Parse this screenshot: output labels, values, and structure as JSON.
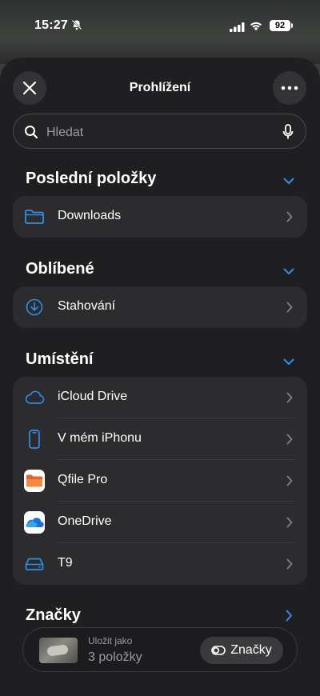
{
  "status_bar": {
    "time": "15:27",
    "battery": "92"
  },
  "sheet": {
    "title": "Prohlížení",
    "close_icon": "close-icon",
    "more_icon": "ellipsis-icon"
  },
  "search": {
    "placeholder": "Hledat",
    "icon": "search-icon",
    "mic_icon": "microphone-icon"
  },
  "sections": {
    "recent": {
      "title": "Poslední položky",
      "items": [
        {
          "label": "Downloads",
          "icon": "folder-icon"
        }
      ]
    },
    "favorites": {
      "title": "Oblíbené",
      "items": [
        {
          "label": "Stahování",
          "icon": "download-circle-icon"
        }
      ]
    },
    "locations": {
      "title": "Umístění",
      "items": [
        {
          "label": "iCloud Drive",
          "icon": "icloud-icon"
        },
        {
          "label": "V mém iPhonu",
          "icon": "iphone-icon"
        },
        {
          "label": "Qfile Pro",
          "icon": "qfile-app-icon"
        },
        {
          "label": "OneDrive",
          "icon": "onedrive-app-icon"
        },
        {
          "label": "T9",
          "icon": "external-drive-icon"
        }
      ]
    },
    "tags": {
      "title": "Značky"
    }
  },
  "bottom_bar": {
    "save_as_label": "Uložit jako",
    "count_label": "3 položky",
    "tags_button": "Značky"
  },
  "colors": {
    "accent": "#2f8fe8",
    "background": "#1f1f21",
    "row_background": "#2c2c2e"
  }
}
